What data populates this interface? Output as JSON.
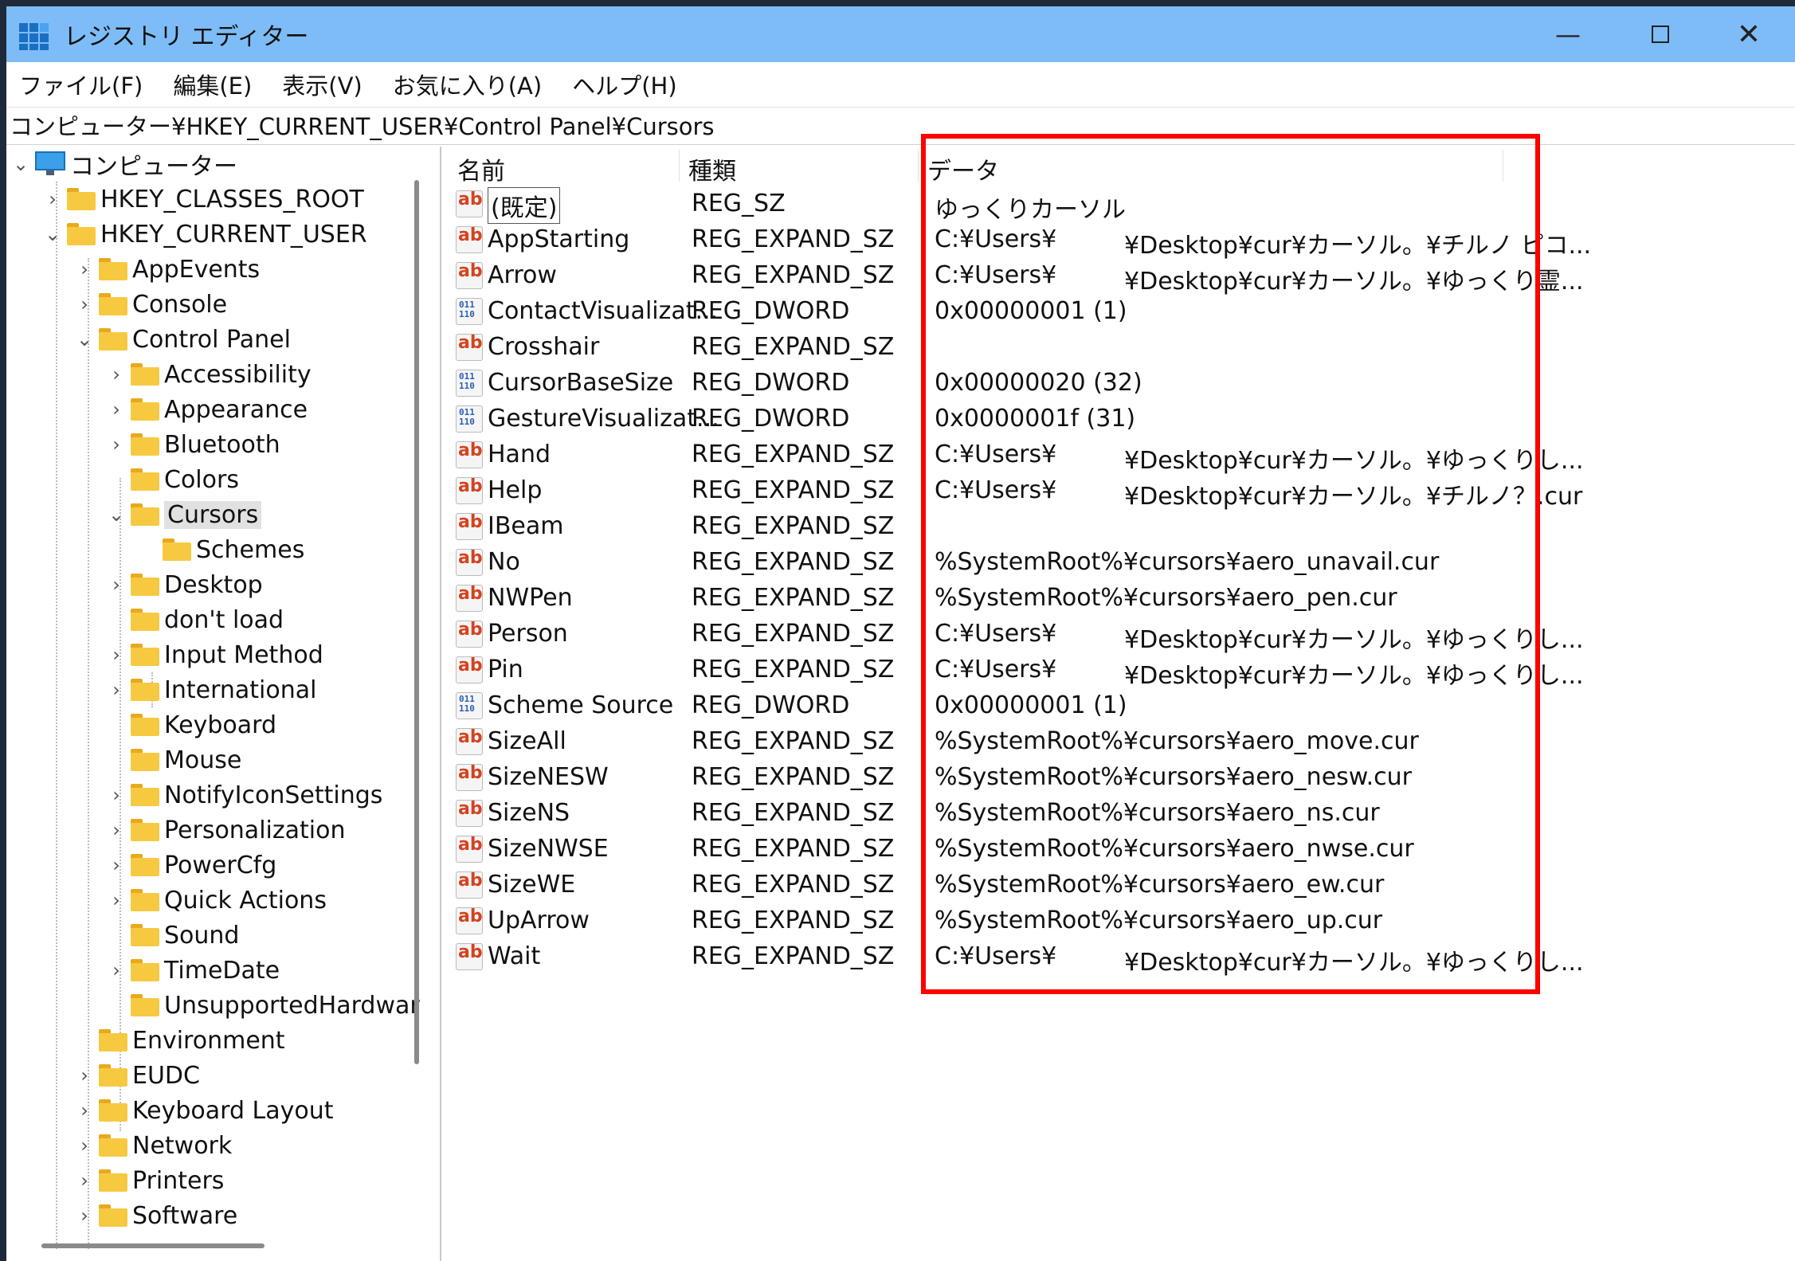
{
  "window": {
    "title": "レジストリ エディター",
    "minimize_icon": "minimize-icon",
    "maximize_icon": "maximize-icon",
    "close_icon": "close-icon"
  },
  "menu": [
    "ファイル(F)",
    "編集(E)",
    "表示(V)",
    "お気に入り(A)",
    "ヘルプ(H)"
  ],
  "address": "コンピューター¥HKEY_CURRENT_USER¥Control Panel¥Cursors",
  "tree": {
    "root": "コンピューター",
    "hkcr": "HKEY_CLASSES_ROOT",
    "hkcu": "HKEY_CURRENT_USER",
    "hkcu_children": [
      "AppEvents",
      "Console",
      "Control Panel"
    ],
    "control_panel_children": [
      "Accessibility",
      "Appearance",
      "Bluetooth",
      "Colors",
      "Cursors",
      "Schemes",
      "Desktop",
      "don't load",
      "Input Method",
      "International",
      "Keyboard",
      "Mouse",
      "NotifyIconSettings",
      "Personalization",
      "PowerCfg",
      "Quick Actions",
      "Sound",
      "TimeDate",
      "UnsupportedHardwar"
    ],
    "hkcu_rest": [
      "Environment",
      "EUDC",
      "Keyboard Layout",
      "Network",
      "Printers",
      "Software"
    ],
    "selected": "Cursors"
  },
  "list": {
    "headers": {
      "name": "名前",
      "type": "種類",
      "data": "データ"
    },
    "rows": [
      {
        "name": "(既定)",
        "type": "REG_SZ",
        "data": "ゆっくりカーソル"
      },
      {
        "name": "AppStarting",
        "type": "REG_EXPAND_SZ",
        "data": "C:¥Users¥",
        "data2": "¥Desktop¥cur¥カーソル。¥チルノ ピコ..."
      },
      {
        "name": "Arrow",
        "type": "REG_EXPAND_SZ",
        "data": "C:¥Users¥",
        "data2": "¥Desktop¥cur¥カーソル。¥ゆっくり霊..."
      },
      {
        "name": "ContactVisualizat...",
        "type": "REG_DWORD",
        "data": "0x00000001 (1)"
      },
      {
        "name": "Crosshair",
        "type": "REG_EXPAND_SZ",
        "data": ""
      },
      {
        "name": "CursorBaseSize",
        "type": "REG_DWORD",
        "data": "0x00000020 (32)"
      },
      {
        "name": "GestureVisualizat...",
        "type": "REG_DWORD",
        "data": "0x0000001f (31)"
      },
      {
        "name": "Hand",
        "type": "REG_EXPAND_SZ",
        "data": "C:¥Users¥",
        "data2": "¥Desktop¥cur¥カーソル。¥ゆっくりし..."
      },
      {
        "name": "Help",
        "type": "REG_EXPAND_SZ",
        "data": "C:¥Users¥",
        "data2": "¥Desktop¥cur¥カーソル。¥チルノ？.cur"
      },
      {
        "name": "IBeam",
        "type": "REG_EXPAND_SZ",
        "data": ""
      },
      {
        "name": "No",
        "type": "REG_EXPAND_SZ",
        "data": "%SystemRoot%¥cursors¥aero_unavail.cur"
      },
      {
        "name": "NWPen",
        "type": "REG_EXPAND_SZ",
        "data": "%SystemRoot%¥cursors¥aero_pen.cur"
      },
      {
        "name": "Person",
        "type": "REG_EXPAND_SZ",
        "data": "C:¥Users¥",
        "data2": "¥Desktop¥cur¥カーソル。¥ゆっくりし..."
      },
      {
        "name": "Pin",
        "type": "REG_EXPAND_SZ",
        "data": "C:¥Users¥",
        "data2": "¥Desktop¥cur¥カーソル。¥ゆっくりし..."
      },
      {
        "name": "Scheme Source",
        "type": "REG_DWORD",
        "data": "0x00000001 (1)"
      },
      {
        "name": "SizeAll",
        "type": "REG_EXPAND_SZ",
        "data": "%SystemRoot%¥cursors¥aero_move.cur"
      },
      {
        "name": "SizeNESW",
        "type": "REG_EXPAND_SZ",
        "data": "%SystemRoot%¥cursors¥aero_nesw.cur"
      },
      {
        "name": "SizeNS",
        "type": "REG_EXPAND_SZ",
        "data": "%SystemRoot%¥cursors¥aero_ns.cur"
      },
      {
        "name": "SizeNWSE",
        "type": "REG_EXPAND_SZ",
        "data": "%SystemRoot%¥cursors¥aero_nwse.cur"
      },
      {
        "name": "SizeWE",
        "type": "REG_EXPAND_SZ",
        "data": "%SystemRoot%¥cursors¥aero_ew.cur"
      },
      {
        "name": "UpArrow",
        "type": "REG_EXPAND_SZ",
        "data": "%SystemRoot%¥cursors¥aero_up.cur"
      },
      {
        "name": "Wait",
        "type": "REG_EXPAND_SZ",
        "data": "C:¥Users¥",
        "data2": "¥Desktop¥cur¥カーソル。¥ゆっくりし..."
      }
    ]
  },
  "icons": {
    "sz": "ab",
    "dw": "011\n110"
  },
  "colors": {
    "titlebar": "#7dbcf6",
    "highlight": "#ff0000"
  }
}
